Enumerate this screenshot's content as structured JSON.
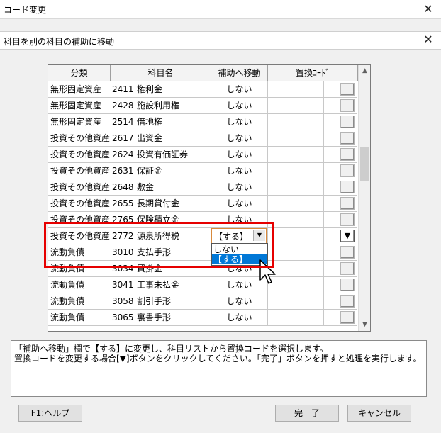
{
  "window": {
    "title": "コード変更"
  },
  "dialog": {
    "title": "科目を別の科目の補助に移動"
  },
  "grid": {
    "headers": [
      "分類",
      "科目名",
      "補助へ移動",
      "置換ｺｰﾄﾞ"
    ],
    "rows": [
      {
        "category": "無形固定資産",
        "code": "2411",
        "name": "権利金",
        "move": "しない"
      },
      {
        "category": "無形固定資産",
        "code": "2428",
        "name": "施設利用権",
        "move": "しない"
      },
      {
        "category": "無形固定資産",
        "code": "2514",
        "name": "借地権",
        "move": "しない"
      },
      {
        "category": "投資その他資産",
        "code": "2617",
        "name": "出資金",
        "move": "しない"
      },
      {
        "category": "投資その他資産",
        "code": "2624",
        "name": "投資有価証券",
        "move": "しない"
      },
      {
        "category": "投資その他資産",
        "code": "2631",
        "name": "保証金",
        "move": "しない"
      },
      {
        "category": "投資その他資産",
        "code": "2648",
        "name": "敷金",
        "move": "しない"
      },
      {
        "category": "投資その他資産",
        "code": "2655",
        "name": "長期貸付金",
        "move": "しない"
      },
      {
        "category": "投資その他資産",
        "code": "2765",
        "name": "保険積立金",
        "move": "しない"
      },
      {
        "category": "投資その他資産",
        "code": "2772",
        "name": "源泉所得税",
        "move": "【する】"
      },
      {
        "category": "流動負債",
        "code": "3010",
        "name": "支払手形",
        "move": ""
      },
      {
        "category": "流動負債",
        "code": "3034",
        "name": "買掛金",
        "move": "しない"
      },
      {
        "category": "流動負債",
        "code": "3041",
        "name": "工事未払金",
        "move": "しない"
      },
      {
        "category": "流動負債",
        "code": "3058",
        "name": "割引手形",
        "move": "しない"
      },
      {
        "category": "流動負債",
        "code": "3065",
        "name": "裏書手形",
        "move": "しない"
      }
    ],
    "selected_button_glyph": "▼"
  },
  "combo": {
    "value": "【する】",
    "options": [
      "しない",
      "【する】"
    ],
    "highlighted": "【する】"
  },
  "message": {
    "line1": "「補助へ移動」欄で【する】に変更し、科目リストから置換コードを選択します。",
    "line2": "置換コードを変更する場合[▼]ボタンをクリックしてください。「完了」ボタンを押すと処理を実行します。"
  },
  "buttons": {
    "help": "F1:ヘルプ",
    "done": "完　了",
    "cancel": "キャンセル"
  },
  "icons": {
    "close": "close-icon",
    "scroll_up": "chevron-up-icon",
    "scroll_down": "chevron-down-icon",
    "pointer": "mouse-pointer-icon"
  },
  "colors": {
    "highlight_border": "#e60000",
    "selection": "#0078d7",
    "combo_border": "#d88a3c"
  }
}
